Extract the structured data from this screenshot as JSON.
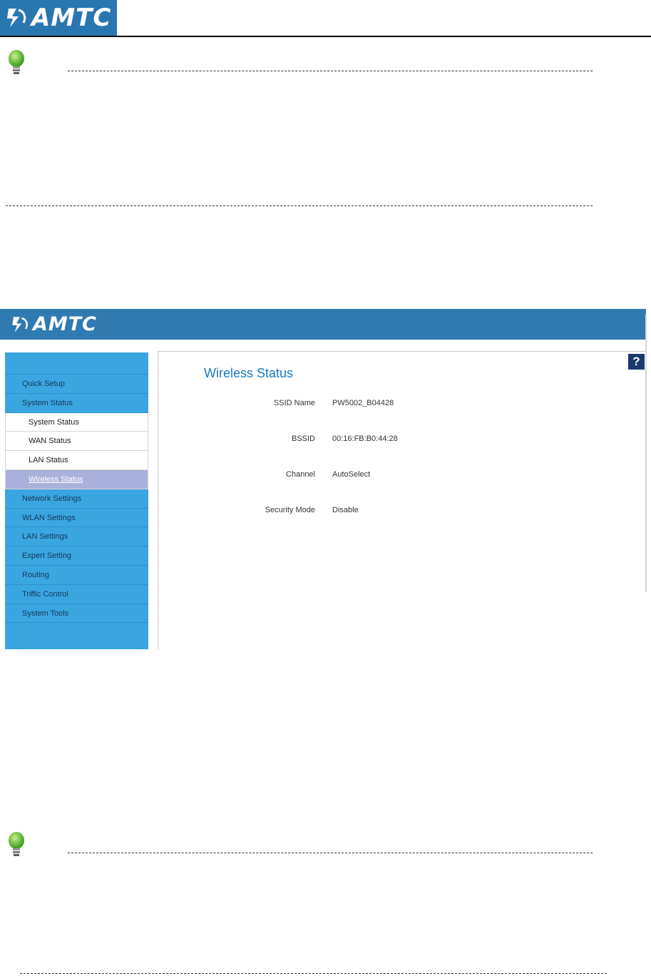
{
  "doc_header": {
    "logo_text": "AMTC"
  },
  "router_ui": {
    "logo_text": "AMTC",
    "help_label": "?",
    "sidebar": {
      "items": [
        {
          "label": "Quick Setup",
          "level": 1
        },
        {
          "label": "System Status",
          "level": 1
        },
        {
          "label": "System Status",
          "level": 2
        },
        {
          "label": "WAN Status",
          "level": 2
        },
        {
          "label": "LAN Status",
          "level": 2
        },
        {
          "label": "Wireless Status",
          "level": 2,
          "active": true
        },
        {
          "label": "Network Settings",
          "level": 1
        },
        {
          "label": "WLAN Settings",
          "level": 1
        },
        {
          "label": "LAN Settings",
          "level": 1
        },
        {
          "label": "Expert Setting",
          "level": 1
        },
        {
          "label": "Routing",
          "level": 1
        },
        {
          "label": "Triffic Control",
          "level": 1
        },
        {
          "label": "System Tools",
          "level": 1
        }
      ]
    },
    "content": {
      "title": "Wireless Status",
      "fields": [
        {
          "label": "SSID Name",
          "value": "PW5002_B04428"
        },
        {
          "label": "BSSID",
          "value": "00:16:FB:B0:44:28"
        },
        {
          "label": "Channel",
          "value": "AutoSelect"
        },
        {
          "label": "Security Mode",
          "value": "Disable"
        }
      ]
    }
  },
  "colors": {
    "banner": "#2f7ab0",
    "sidebar": "#3aa6e0",
    "active_item": "#aab0dc",
    "title": "#1778c4",
    "bulb": "#6cc24a"
  }
}
